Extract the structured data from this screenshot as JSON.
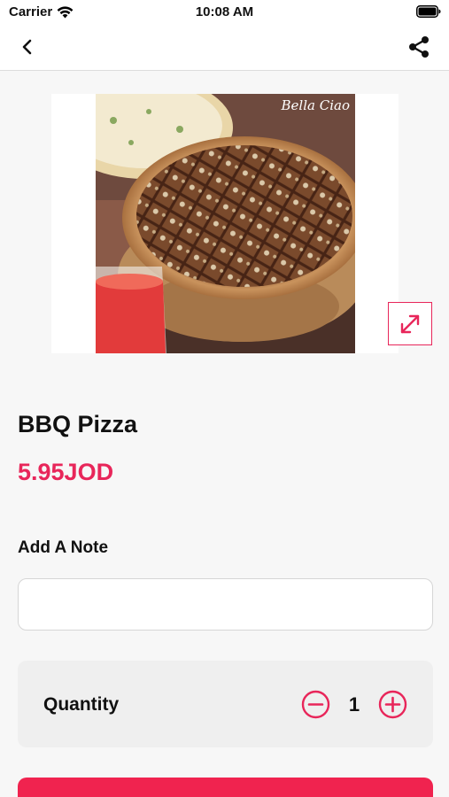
{
  "status_bar": {
    "carrier": "Carrier",
    "time": "10:08 AM"
  },
  "nav": {
    "back_icon": "chevron-left-icon",
    "share_icon": "share-icon"
  },
  "product": {
    "photo_brand": "Bella Ciao",
    "name": "BBQ Pizza",
    "price": "5.95JOD"
  },
  "note": {
    "label": "Add A Note",
    "value": "",
    "placeholder": ""
  },
  "quantity": {
    "label": "Quantity",
    "value": "1"
  },
  "colors": {
    "accent": "#e8265a",
    "button": "#f0234f",
    "background": "#f7f7f7"
  }
}
